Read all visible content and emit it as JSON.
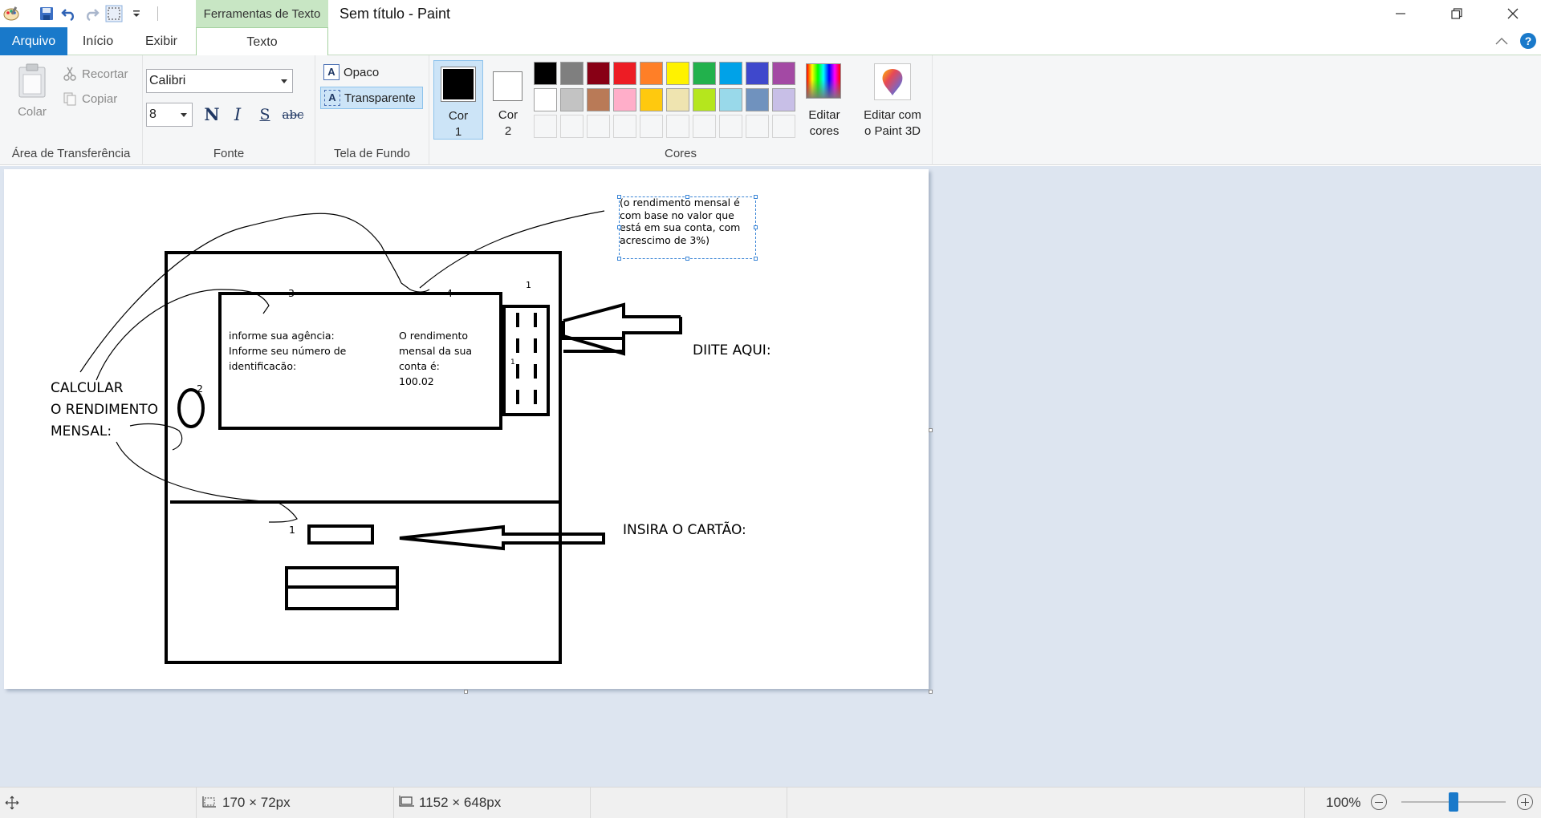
{
  "window": {
    "title": "Sem título - Paint",
    "context_tab_header": "Ferramentas de Texto"
  },
  "tabs": [
    "Arquivo",
    "Início",
    "Exibir",
    "Texto"
  ],
  "clipboard": {
    "paste_label": "Colar",
    "cut_label": "Recortar",
    "copy_label": "Copiar",
    "group_label": "Área de Transferência"
  },
  "font": {
    "family": "Calibri",
    "size": "8",
    "bold": "N",
    "italic": "I",
    "underline": "S",
    "strike": "abc",
    "group_label": "Fonte"
  },
  "background": {
    "opaque_label": "Opaco",
    "transparent_label": "Transparente",
    "group_label": "Tela de Fundo"
  },
  "colors": {
    "color1_label": "Cor\n1",
    "color2_label": "Cor\n2",
    "color1_value": "#000000",
    "color2_value": "#ffffff",
    "palette_row1": [
      "#000000",
      "#7f7f7f",
      "#880015",
      "#ed1c24",
      "#ff7f27",
      "#fff200",
      "#22b14c",
      "#00a2e8",
      "#3f48cc",
      "#a349a4"
    ],
    "palette_row2": [
      "#ffffff",
      "#c3c3c3",
      "#b97a57",
      "#ffaec9",
      "#ffc90e",
      "#efe4b0",
      "#b5e61d",
      "#99d9ea",
      "#7092be",
      "#c8bfe7"
    ],
    "edit_colors_label": "Editar\ncores",
    "group_label": "Cores"
  },
  "paint3d": {
    "label": "Editar com\no Paint 3D"
  },
  "canvas_text": {
    "note": "(o rendimento mensal é\ncom base no valor que\nestá em sua conta, com\nacrescimo de 3%)",
    "num3": "3",
    "num4": "4",
    "num2": "2",
    "num1": "1",
    "screen_left": "informe sua agência:\nInforme seu número de\nidentificacão:",
    "screen_right": "O rendimento\nmensal da sua\nconta é:\n100.02",
    "calc": "CALCULAR\nO RENDIMENTO\nMENSAL:",
    "diite": "DIITE AQUI:",
    "insira": "INSIRA O CARTÃO:"
  },
  "status": {
    "selection_size": "170 × 72px",
    "image_size": "1152 × 648px",
    "zoom": "100%",
    "zoom_fraction": 0.5
  }
}
